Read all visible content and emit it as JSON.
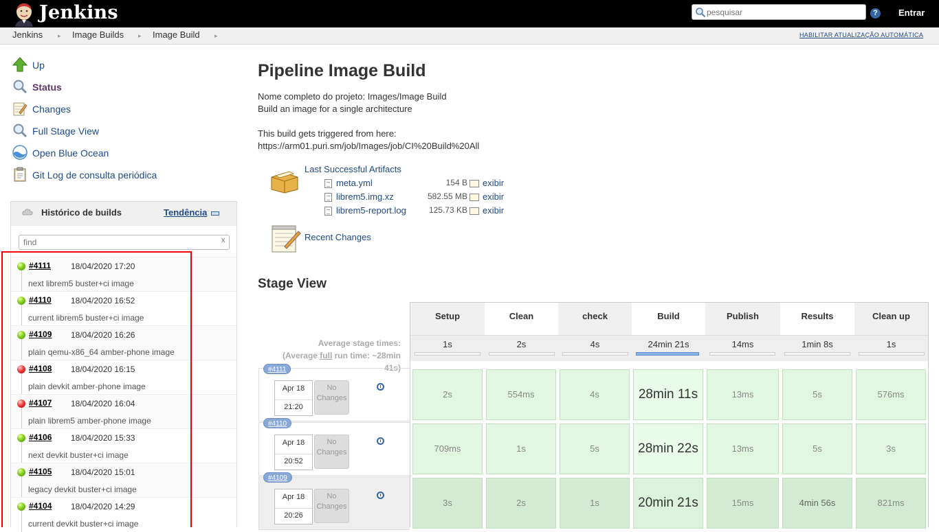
{
  "header": {
    "logo_text": "Jenkins",
    "search_placeholder": "pesquisar",
    "help": "?",
    "login": "Entrar"
  },
  "breadcrumb": {
    "items": [
      "Jenkins",
      "Image Builds",
      "Image Build"
    ],
    "auto_refresh": "HABILITAR ATUALIZAÇÃO AUTOMÁTICA"
  },
  "sidebar": {
    "tasks": [
      {
        "label": "Up",
        "icon": "up-arrow-icon"
      },
      {
        "label": "Status",
        "icon": "search-icon"
      },
      {
        "label": "Changes",
        "icon": "notepad-icon"
      },
      {
        "label": "Full Stage View",
        "icon": "search-icon"
      },
      {
        "label": "Open Blue Ocean",
        "icon": "blue-ocean-icon"
      },
      {
        "label": "Git Log de consulta periódica",
        "icon": "clipboard-icon"
      }
    ],
    "build_history": {
      "title": "Histórico de builds",
      "trend": "Tendência",
      "find_placeholder": "find",
      "clear": "x",
      "builds": [
        {
          "number": "#4111",
          "date": "18/04/2020 17:20",
          "desc": "next librem5 buster+ci image",
          "status": "success"
        },
        {
          "number": "#4110",
          "date": "18/04/2020 16:52",
          "desc": "current librem5 buster+ci image",
          "status": "success"
        },
        {
          "number": "#4109",
          "date": "18/04/2020 16:26",
          "desc": "plain qemu-x86_64 amber-phone image",
          "status": "success"
        },
        {
          "number": "#4108",
          "date": "18/04/2020 16:15",
          "desc": "plain devkit amber-phone image",
          "status": "failed"
        },
        {
          "number": "#4107",
          "date": "18/04/2020 16:04",
          "desc": "plain librem5 amber-phone image",
          "status": "failed"
        },
        {
          "number": "#4106",
          "date": "18/04/2020 15:33",
          "desc": "next devkit buster+ci image",
          "status": "success"
        },
        {
          "number": "#4105",
          "date": "18/04/2020 15:01",
          "desc": "legacy devkit buster+ci image",
          "status": "success"
        },
        {
          "number": "#4104",
          "date": "18/04/2020 14:29",
          "desc": "current devkit buster+ci image",
          "status": "success"
        }
      ]
    }
  },
  "main": {
    "title": "Pipeline Image Build",
    "full_name": "Nome completo do projeto: Images/Image Build",
    "description": "Build an image for a single architecture",
    "trigger_text": "This build gets triggered from here:",
    "trigger_url": "https://arm01.puri.sm/job/Images/job/CI%20Build%20All",
    "artifacts_link": "Last Successful Artifacts",
    "artifacts": [
      {
        "name": "meta.yml",
        "size": "154 B",
        "view": "exibir"
      },
      {
        "name": "librem5.img.xz",
        "size": "582.55 MB",
        "view": "exibir"
      },
      {
        "name": "librem5-report.log",
        "size": "125.73 KB",
        "view": "exibir"
      }
    ],
    "recent_changes": "Recent Changes"
  },
  "stage_view": {
    "title": "Stage View",
    "avg_label_1": "Average stage times:",
    "avg_label_2": "(Average ",
    "avg_label_full": "full",
    "avg_label_3": " run time: ~28min",
    "avg_label_4": "41s)",
    "stages": [
      "Setup",
      "Clean",
      "check",
      "Build",
      "Publish",
      "Results",
      "Clean up"
    ],
    "averages": [
      "1s",
      "2s",
      "4s",
      "24min 21s",
      "14ms",
      "1min 8s",
      "1s"
    ],
    "runs": [
      {
        "badge": "#4111",
        "month_day": "Apr 18",
        "time": "21:20",
        "no_changes": "No Changes",
        "cells": [
          "2s",
          "554ms",
          "4s",
          "28min 11s",
          "13ms",
          "5s",
          "576ms"
        ]
      },
      {
        "badge": "#4110",
        "month_day": "Apr 18",
        "time": "20:52",
        "no_changes": "No Changes",
        "cells": [
          "709ms",
          "1s",
          "5s",
          "28min 22s",
          "13ms",
          "5s",
          "3s"
        ]
      },
      {
        "badge": "#4109",
        "month_day": "Apr 18",
        "time": "20:26",
        "no_changes": "No Changes",
        "cells": [
          "3s",
          "2s",
          "1s",
          "20min 21s",
          "15ms",
          "4min 56s",
          "821ms"
        ]
      }
    ]
  },
  "colors": {
    "header_bg": "#000000",
    "link": "#204a87",
    "success": "#8fd424",
    "failed": "#ef3d3d",
    "stage_cell": "#e2f7e2",
    "highlight": "#ee0000"
  }
}
